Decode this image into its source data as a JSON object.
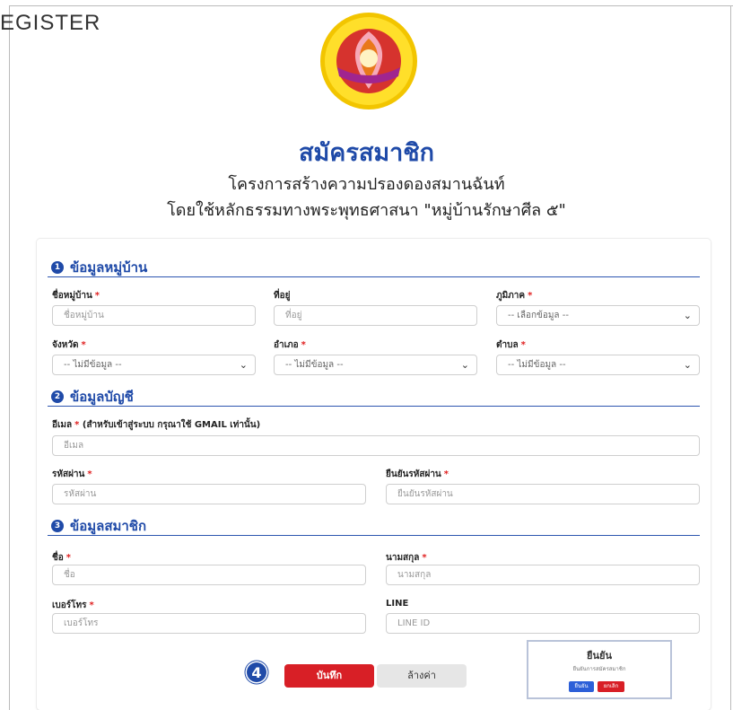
{
  "brand": "EGISTER",
  "page": {
    "title": "สมัครสมาชิก",
    "subtitle_line1": "โครงการสร้างความปรองดองสมานฉันท์",
    "subtitle_line2": "โดยใช้หลักธรรมทางพระพุทธศาสนา \"หมู่บ้านรักษาศีล ๕\""
  },
  "sections": {
    "village": {
      "num": "1",
      "title": "ข้อมูลหมู่บ้าน"
    },
    "account": {
      "num": "2",
      "title": "ข้อมูลบัญชี"
    },
    "member": {
      "num": "3",
      "title": "ข้อมูลสมาชิก"
    }
  },
  "fields": {
    "village_name": {
      "label": "ชื่อหมู่บ้าน",
      "placeholder": "ชื่อหมู่บ้าน"
    },
    "address": {
      "label": "ที่อยู่",
      "placeholder": "ที่อยู่"
    },
    "region": {
      "label": "ภูมิภาค",
      "value": "-- เลือกข้อมูล --"
    },
    "province": {
      "label": "จังหวัด",
      "value": "-- ไม่มีข้อมูล --"
    },
    "district": {
      "label": "อำเภอ",
      "value": "-- ไม่มีข้อมูล --"
    },
    "subdistrict": {
      "label": "ตำบล",
      "value": "-- ไม่มีข้อมูล --"
    },
    "email": {
      "label": "อีเมล",
      "note": "(สำหรับเข้าสู่ระบบ กรุณาใช้ GMAIL เท่านั้น)",
      "placeholder": "อีเมล"
    },
    "password": {
      "label": "รหัสผ่าน",
      "placeholder": "รหัสผ่าน"
    },
    "confirm_password": {
      "label": "ยืนยันรหัสผ่าน",
      "placeholder": "ยืนยันรหัสผ่าน"
    },
    "first_name": {
      "label": "ชื่อ",
      "placeholder": "ชื่อ"
    },
    "last_name": {
      "label": "นามสกุล",
      "placeholder": "นามสกุล"
    },
    "phone": {
      "label": "เบอร์โทร",
      "placeholder": "เบอร์โทร"
    },
    "line": {
      "label": "LINE",
      "placeholder": "LINE ID"
    }
  },
  "required_mark": "*",
  "buttons": {
    "save": "บันทึก",
    "clear": "ล้างค่า"
  },
  "step_badge": "4",
  "confirm_dialog": {
    "title": "ยืนยัน",
    "message": "ยืนยันการสมัครสมาชิก",
    "ok": "ยืนยัน",
    "cancel": "ยกเลิก"
  },
  "colors": {
    "accent": "#1f4aa8",
    "danger": "#d81f26"
  },
  "icons": {
    "select_arrow": "chevron-down-icon",
    "logo": "village-logo"
  }
}
